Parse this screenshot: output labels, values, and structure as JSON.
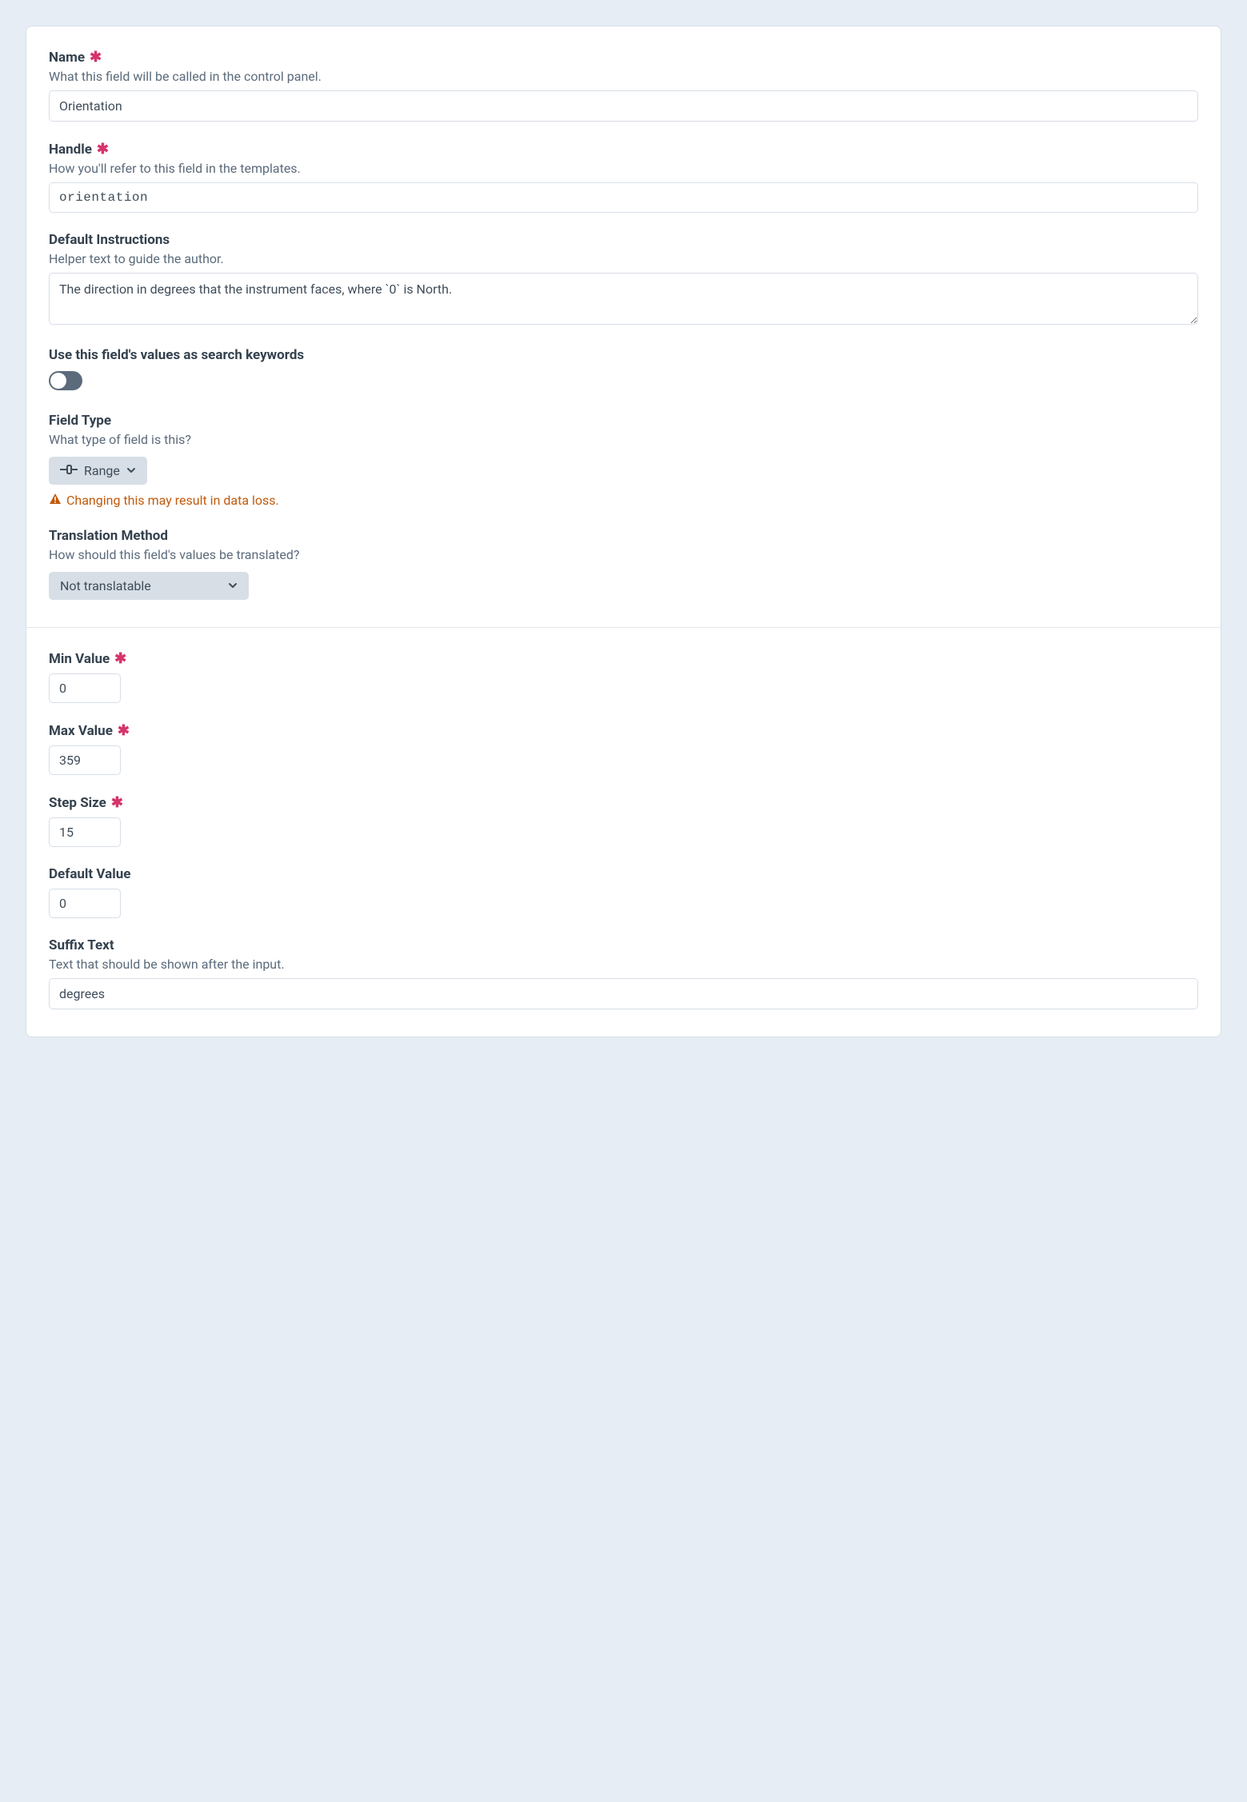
{
  "name": {
    "label": "Name",
    "help": "What this field will be called in the control panel.",
    "value": "Orientation"
  },
  "handle": {
    "label": "Handle",
    "help": "How you'll refer to this field in the templates.",
    "value": "orientation"
  },
  "instructions": {
    "label": "Default Instructions",
    "help": "Helper text to guide the author.",
    "value": "The direction in degrees that the instrument faces, where `0` is North."
  },
  "searchable": {
    "label": "Use this field's values as search keywords",
    "on": false
  },
  "fieldType": {
    "label": "Field Type",
    "help": "What type of field is this?",
    "value": "Range",
    "warning": "Changing this may result in data loss."
  },
  "translation": {
    "label": "Translation Method",
    "help": "How should this field's values be translated?",
    "value": "Not translatable"
  },
  "minValue": {
    "label": "Min Value",
    "value": "0"
  },
  "maxValue": {
    "label": "Max Value",
    "value": "359"
  },
  "stepSize": {
    "label": "Step Size",
    "value": "15"
  },
  "defaultValue": {
    "label": "Default Value",
    "value": "0"
  },
  "suffix": {
    "label": "Suffix Text",
    "help": "Text that should be shown after the input.",
    "value": "degrees"
  }
}
